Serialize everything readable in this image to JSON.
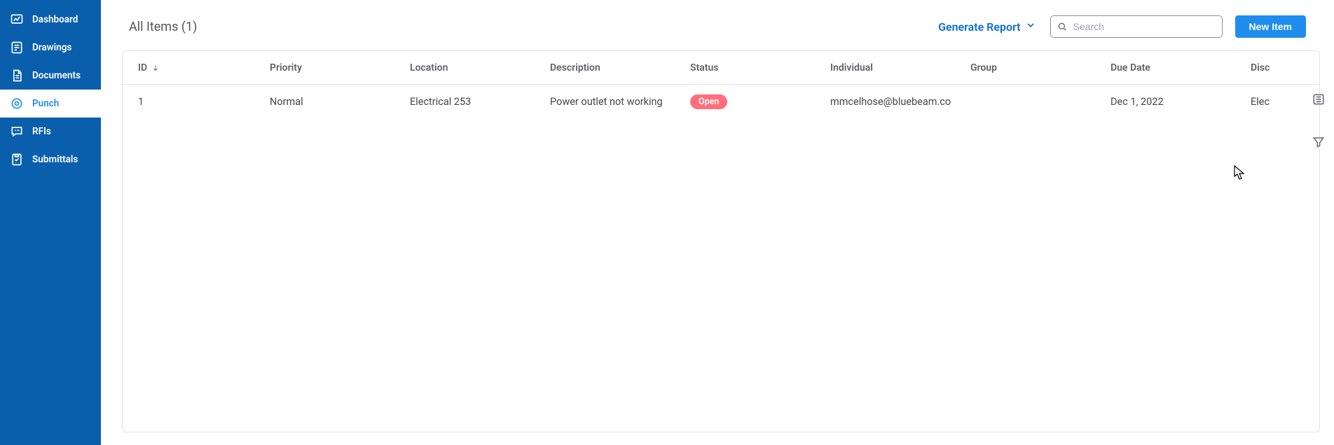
{
  "sidebar": {
    "items": [
      {
        "label": "Dashboard"
      },
      {
        "label": "Drawings"
      },
      {
        "label": "Documents"
      },
      {
        "label": "Punch"
      },
      {
        "label": "RFIs"
      },
      {
        "label": "Submittals"
      }
    ]
  },
  "header": {
    "title": "All Items (1)",
    "generate_report": "Generate Report",
    "search_placeholder": "Search",
    "new_item": "New Item"
  },
  "table": {
    "columns": {
      "id": "ID",
      "priority": "Priority",
      "location": "Location",
      "description": "Description",
      "status": "Status",
      "individual": "Individual",
      "group": "Group",
      "due_date": "Due Date",
      "discipline": "Disc"
    },
    "rows": [
      {
        "id": "1",
        "priority": "Normal",
        "location": "Electrical 253",
        "description": "Power outlet not working",
        "status": "Open",
        "individual": "mmcelhose@bluebeam.co",
        "group": "",
        "due_date": "Dec 1, 2022",
        "discipline": "Elec"
      }
    ]
  }
}
